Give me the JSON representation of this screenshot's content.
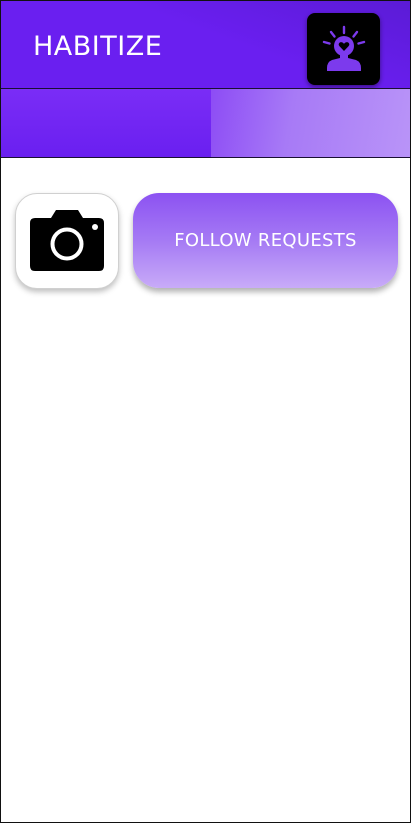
{
  "header": {
    "title": "HABITIZE",
    "profile_icon": "idea-person-heart-icon",
    "background": "#6a1ff0",
    "icon_color": "#7c3aed"
  },
  "actions": {
    "camera_icon": "camera-icon",
    "follow_requests_label": "FOLLOW REQUESTS"
  }
}
